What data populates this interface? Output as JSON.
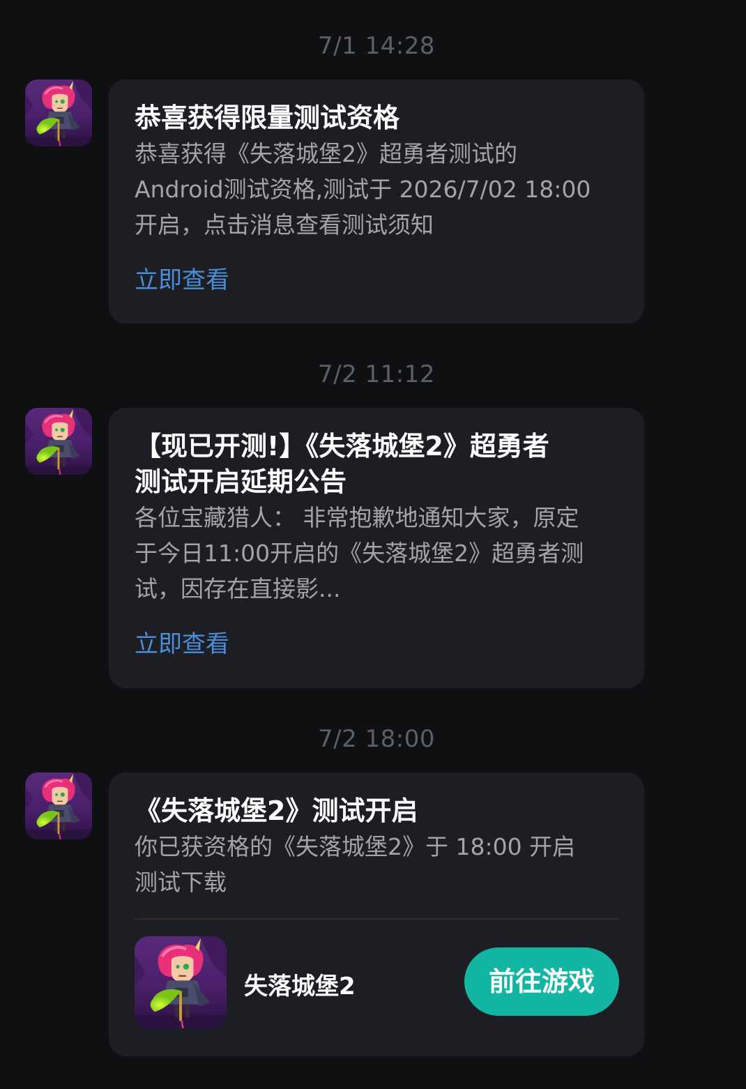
{
  "messages": [
    {
      "time": "7/1  14:28",
      "title": "恭喜获得限量测试资格",
      "body": "恭喜获得《失落城堡2》超勇者测试的\nAndroid测试资格,测试于 2026/7/02 18:00\n开启，点击消息查看测试须知",
      "link": "立即查看"
    },
    {
      "time": "7/2  11:12",
      "title": "【现已开测!】《失落城堡2》超勇者\n测试开启延期公告",
      "body": "各位宝藏猎人： 非常抱歉地通知大家，原定\n于今日11:00开启的《失落城堡2》超勇者测\n试，因存在直接影...",
      "link": "立即查看"
    },
    {
      "time": "7/2  18:00",
      "title": "《失落城堡2》测试开启",
      "body": "你已获资格的《失落城堡2》于 18:00 开启\n测试下载",
      "game_name": "失落城堡2",
      "action_label": "前往游戏"
    }
  ],
  "icons": {
    "avatar": "game-avatar-icon",
    "game": "game-app-icon"
  },
  "colors": {
    "background": "#0f1012",
    "card": "#1d1e23",
    "link": "#4a8ed8",
    "button": "#12b6a3"
  }
}
